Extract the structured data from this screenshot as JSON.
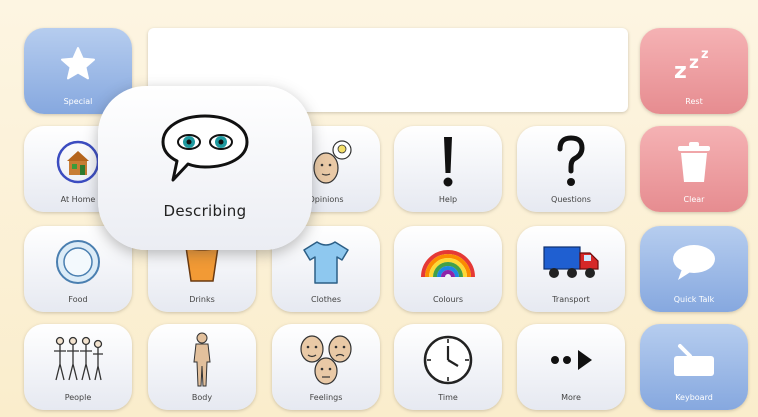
{
  "colors": {
    "background": "#fbf2dc",
    "tile": "#e6e9f1",
    "blue_tile": "#86a8df",
    "red_tile": "#e68c90"
  },
  "message_bar": {
    "value": ""
  },
  "popup": {
    "label": "Describing",
    "icon": "speech-bubble-eyes-icon"
  },
  "tiles": {
    "special": {
      "label": "Special",
      "icon": "star-icon"
    },
    "rest": {
      "label": "Rest",
      "icon": "zzz-icon"
    },
    "at_home": {
      "label": "At Home",
      "icon": "house-icon"
    },
    "opinions": {
      "label": "Opinions",
      "icon": "thinking-faces-icon"
    },
    "help": {
      "label": "Help",
      "icon": "exclamation-icon"
    },
    "questions": {
      "label": "Questions",
      "icon": "question-mark-icon"
    },
    "clear": {
      "label": "Clear",
      "icon": "trash-icon"
    },
    "food": {
      "label": "Food",
      "icon": "plate-icon"
    },
    "drinks": {
      "label": "Drinks",
      "icon": "cup-icon"
    },
    "clothes": {
      "label": "Clothes",
      "icon": "tshirt-icon"
    },
    "colours": {
      "label": "Colours",
      "icon": "rainbow-icon"
    },
    "transport": {
      "label": "Transport",
      "icon": "truck-icon"
    },
    "quick_talk": {
      "label": "Quick Talk",
      "icon": "speech-bubble-icon"
    },
    "people": {
      "label": "People",
      "icon": "people-icon"
    },
    "body": {
      "label": "Body",
      "icon": "body-icon"
    },
    "feelings": {
      "label": "Feelings",
      "icon": "faces-icon"
    },
    "time": {
      "label": "Time",
      "icon": "clock-icon"
    },
    "more": {
      "label": "More",
      "icon": "more-arrow-icon"
    },
    "keyboard": {
      "label": "Keyboard",
      "icon": "keyboard-icon"
    }
  }
}
